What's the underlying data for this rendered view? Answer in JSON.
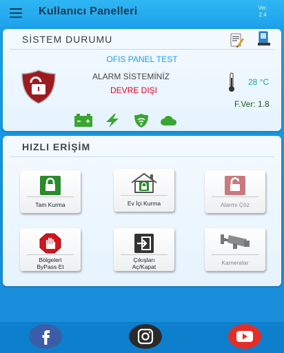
{
  "appbar": {
    "title": "Kullanıcı Panelleri",
    "version_line1": "Ver.",
    "version_line2": "2.4"
  },
  "status_card": {
    "heading": "SİSTEM DURUMU",
    "panel_name": "OFIS PANEL TEST",
    "alarm_label": "ALARM SİSTEMİNİZ",
    "alarm_status": "DEVRE DIŞI",
    "temperature": "28 °C",
    "firmware": "F.Ver: 1.8",
    "icons": [
      "battery-icon",
      "power-icon",
      "signal-shield-icon",
      "cloud-icon"
    ]
  },
  "quick_card": {
    "heading": "HIZLI ERİŞİM",
    "tiles": [
      {
        "label": "Tam Kurma",
        "icon": "lock-icon"
      },
      {
        "label": "Ev İçi Kurma",
        "icon": "home-lock-icon"
      },
      {
        "label": "Alarmı Çöz",
        "icon": "unlock-icon"
      },
      {
        "label1": "Bölgeleri",
        "label2": "ByPass Et",
        "icon": "stop-hand-icon"
      },
      {
        "label1": "Çıkışları",
        "label2": "Aç/Kapat",
        "icon": "exit-icon"
      },
      {
        "label": "Kameralar",
        "icon": "camera-icon"
      }
    ]
  },
  "social": [
    "facebook-icon",
    "instagram-icon",
    "youtube-icon"
  ],
  "colors": {
    "accent": "#1aa3ea",
    "alert_red": "#e8001e",
    "status_green": "#3aa532",
    "shield_red": "#9b1b1f"
  }
}
